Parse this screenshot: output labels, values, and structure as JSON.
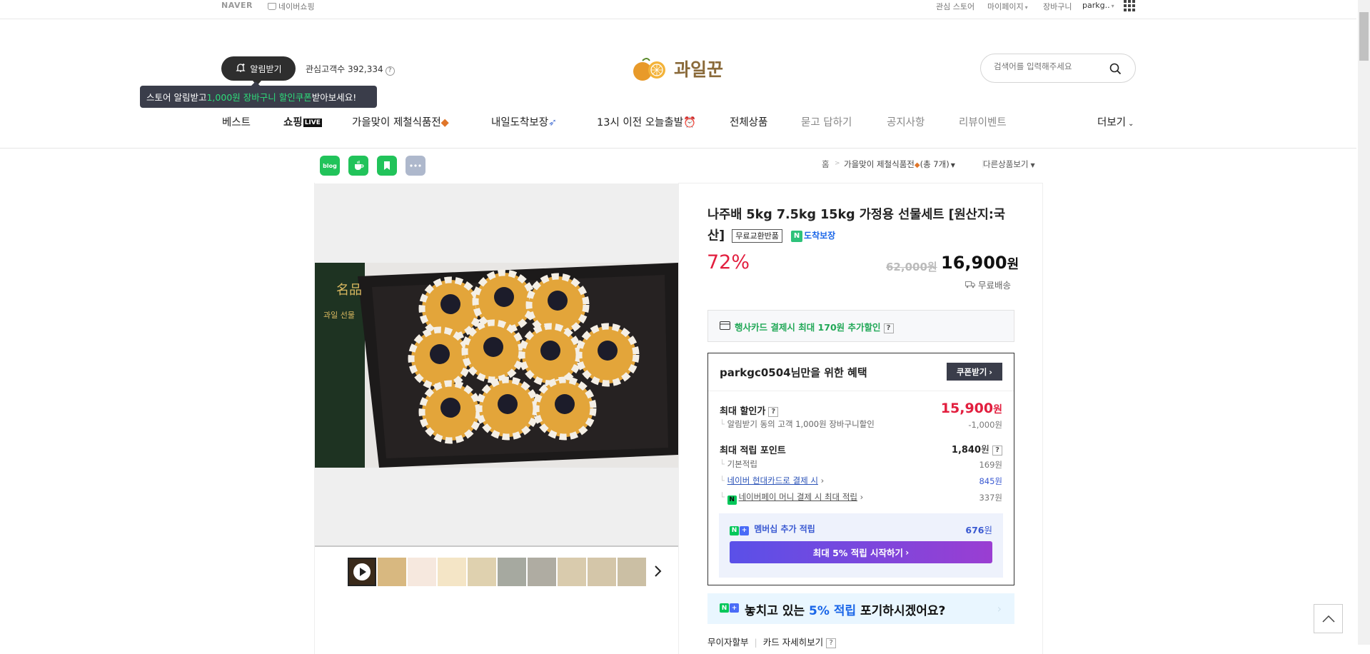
{
  "topbar": {
    "naver": "NAVER",
    "naver_shopping": "네이버쇼핑",
    "right_links": [
      "관심 스토어",
      "마이페이지",
      "장바구니",
      "parkg.."
    ]
  },
  "header": {
    "alarm_button": "알림받기",
    "interest_count_label": "관심고객수 392,334",
    "logo_text": "과일꾼",
    "tooltip": {
      "prefix": "스토어 알림받고 ",
      "highlight": "1,000원 장바구니 할인쿠폰",
      "suffix": " 받아보세요!"
    },
    "search_placeholder": "검색어를 입력해주세요"
  },
  "nav": {
    "items": [
      "베스트",
      "쇼핑",
      "가을맞이 제철식품전",
      "내일도착보장",
      "13시 이전 오늘출발",
      "전체상품",
      "묻고 답하기",
      "공지사항",
      "리뷰이벤트"
    ],
    "live_badge": "LIVE",
    "more": "더보기"
  },
  "share": {
    "blog_label": "blog"
  },
  "breadcrumb": {
    "home": "홈",
    "category": "가을맞이 제철식품전",
    "count": "(총 7개)",
    "other": "다른상품보기"
  },
  "product": {
    "title": "나주배 5kg 7.5kg 15kg 가정용 선물세트 [원산지:국산]",
    "badge_free_return": "무료교환반품",
    "npay_badge": "도착보장",
    "discount_rate": "72%",
    "original_price": "62,000원",
    "price": "16,900",
    "price_unit": "원",
    "shipping": "무료배송",
    "card_promo": "행사카드 결제시 최대 170원 추가할인"
  },
  "benefit": {
    "user": "parkgc0504",
    "title_suffix": "님만을 위한 혜택",
    "coupon_button": "쿠폰받기",
    "max_discount_label": "최대 할인가",
    "max_discount_value": "15,900",
    "max_discount_unit": "원",
    "max_discount_sub": "알림받기 동의 고객 1,000원 장바구니할인",
    "max_discount_sub_value": "-1,000원",
    "points_label": "최대 적립 포인트",
    "points_value": "1,840",
    "points_unit": "원",
    "basic_label": "기본적립",
    "basic_value": "169원",
    "hyundai_label": "네이버 현대카드로 결제 시",
    "hyundai_value": "845원",
    "npay_label": "네이버페이 머니 결제 시 최대 적립",
    "npay_value": "337원",
    "membership_label": "멤버십 추가 적립",
    "membership_value": "676",
    "membership_unit": "원",
    "cta": "최대 5% 적립 시작하기"
  },
  "banner": {
    "prefix": "놓치고 있는 ",
    "highlight": "5% 적립",
    "suffix": " 포기하시겠어요?"
  },
  "bottom": {
    "installment": "무이자할부",
    "card_detail": "카드 자세히보기"
  },
  "colors": {
    "discount_red": "#e21e3e",
    "naver_green": "#03c75a",
    "link_blue": "#2b53b8"
  }
}
